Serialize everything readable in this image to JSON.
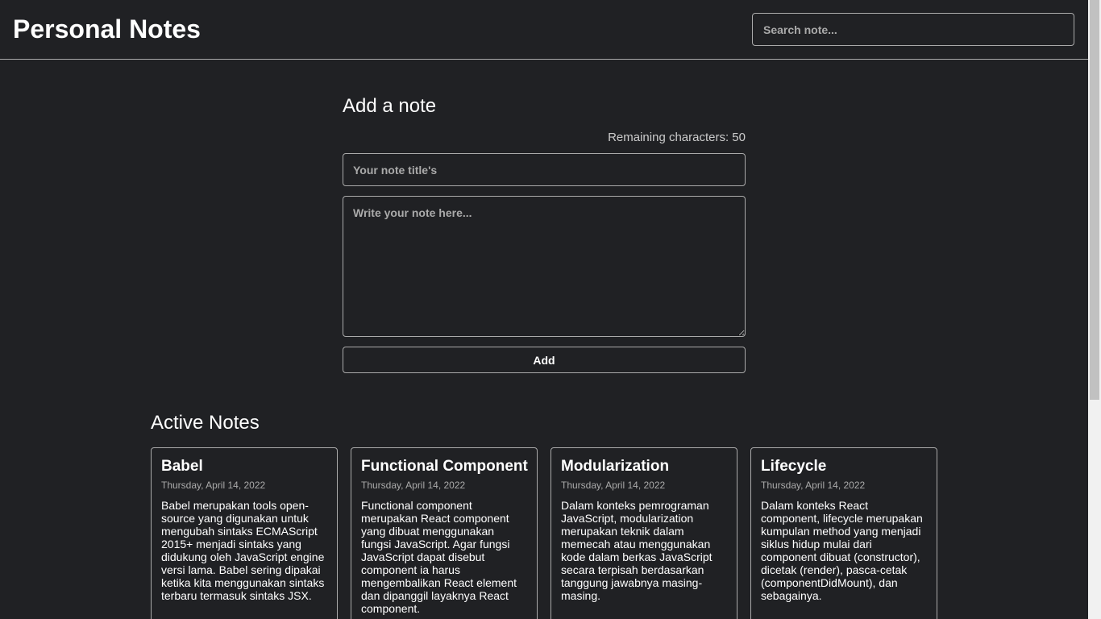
{
  "header": {
    "title": "Personal Notes",
    "search_placeholder": "Search note..."
  },
  "add_note": {
    "heading": "Add a note",
    "char_limit_text": "Remaining characters: 50",
    "title_placeholder": "Your note title's",
    "body_placeholder": "Write your note here...",
    "button_label": "Add"
  },
  "active_notes": {
    "heading": "Active Notes",
    "notes": [
      {
        "title": "Babel",
        "date": "Thursday, April 14, 2022",
        "body": "Babel merupakan tools open-source yang digunakan untuk mengubah sintaks ECMAScript 2015+ menjadi sintaks yang didukung oleh JavaScript engine versi lama. Babel sering dipakai ketika kita menggunakan sintaks terbaru termasuk sintaks JSX."
      },
      {
        "title": "Functional Component",
        "date": "Thursday, April 14, 2022",
        "body": "Functional component merupakan React component yang dibuat menggunakan fungsi JavaScript. Agar fungsi JavaScript dapat disebut component ia harus mengembalikan React element dan dipanggil layaknya React component."
      },
      {
        "title": "Modularization",
        "date": "Thursday, April 14, 2022",
        "body": "Dalam konteks pemrograman JavaScript, modularization merupakan teknik dalam memecah atau menggunakan kode dalam berkas JavaScript secara terpisah berdasarkan tanggung jawabnya masing-masing."
      },
      {
        "title": "Lifecycle",
        "date": "Thursday, April 14, 2022",
        "body": "Dalam konteks React component, lifecycle merupakan kumpulan method yang menjadi siklus hidup mulai dari component dibuat (constructor), dicetak (render), pasca-cetak (componentDidMount), dan sebagainya."
      }
    ]
  }
}
